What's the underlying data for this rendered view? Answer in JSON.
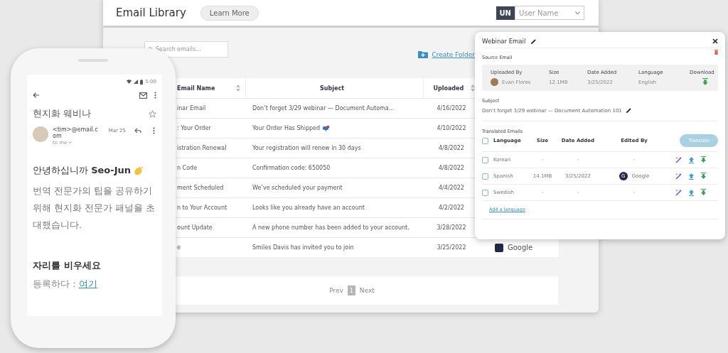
{
  "library": {
    "title": "Email Library",
    "learn_more": "Learn More",
    "user": {
      "initials": "UN",
      "placeholder": "User Name"
    },
    "search": {
      "placeholder": "Search emails..."
    },
    "create_folder": "Create Folder",
    "table": {
      "columns": [
        {
          "label": "Email Name",
          "sortable": true
        },
        {
          "label": "Subject",
          "sortable": false
        },
        {
          "label": "Uploaded",
          "sortable": true
        }
      ],
      "rows": [
        {
          "email_name": "inar Email",
          "subject": "Don’t forget 3/29 webinar — Document Automa...",
          "subject_icon": false,
          "uploaded": "4/16/2022"
        },
        {
          "email_name": ": Your Order",
          "subject": "Your Order Has Shipped",
          "subject_icon": true,
          "uploaded": "4/10/2022"
        },
        {
          "email_name": "istration Renewal",
          "subject": "Your registration will renew in 30 days",
          "subject_icon": false,
          "uploaded": "4/8/2022"
        },
        {
          "email_name": "n Code",
          "subject": "Confirmation code: 650050",
          "subject_icon": false,
          "uploaded": "4/8/2022"
        },
        {
          "email_name": "ment Scheduled",
          "subject": "We’ve scheduled your payment",
          "subject_icon": false,
          "uploaded": "4/4/2022"
        },
        {
          "email_name": "n to Your Account",
          "subject": "Looks like you already have an account",
          "subject_icon": false,
          "uploaded": "4/2/2022"
        },
        {
          "email_name": "ount Update",
          "subject": "A new phone number has been added to your account.",
          "subject_icon": false,
          "uploaded": "3/28/2022"
        },
        {
          "email_name": "e",
          "subject": "Smiles Davis has invited you to join",
          "subject_icon": false,
          "uploaded": "3/25/2022",
          "edited_by": "Google"
        }
      ]
    },
    "pagination": {
      "prev": "Prev",
      "pages": [
        {
          "label": "1",
          "selected": true
        }
      ],
      "next": "Next"
    }
  },
  "phone": {
    "time": "5:00",
    "title": "현지화 웨비나",
    "starred": false,
    "sender": "<tim>@email.com",
    "date": "Mar 25",
    "recipient": "to me",
    "greeting": "안녕하십니까  **Seo-Jun**",
    "body": "번역 전문가의 팁을 공유하기 위해 현지화 전문가 패널을 초대했습니다.",
    "heading": "자리를 비우세요",
    "register_label": "등록하다 : ",
    "register_link": "여기"
  },
  "panel": {
    "title": "Webinar Email",
    "source_label": "Source Email",
    "source": {
      "columns": [
        "Uploaded By",
        "Size",
        "Date Added",
        "Language",
        "Download"
      ],
      "uploaded_by": "Evan Flores",
      "size": "12.1MB",
      "date_added": "3/25/2022",
      "language": "English"
    },
    "subject_label": "Subject",
    "subject": "Don’t forget 3/29 webinar — Document Automation 101",
    "translated_label": "Translated Emails",
    "translate_button": {
      "label": "Translate",
      "disabled": true
    },
    "columns": [
      "Language",
      "Size",
      "Date Added",
      "Edited By"
    ],
    "all_checked": false,
    "rows": [
      {
        "language": "Korean",
        "checked": false,
        "size": "-",
        "date_added": "-",
        "edited_by": "-"
      },
      {
        "language": "Spanish",
        "checked": false,
        "size": "14.1MB",
        "date_added": "3/25/2022",
        "editor_initial": "G",
        "edited_by": "Google"
      },
      {
        "language": "Swedish",
        "checked": false,
        "size": "-",
        "date_added": "-",
        "edited_by": "-"
      }
    ],
    "add_language": "Add a language"
  }
}
